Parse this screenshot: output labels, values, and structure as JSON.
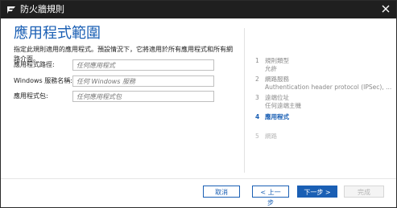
{
  "window": {
    "title": "防火牆規則"
  },
  "page": {
    "heading": "應用程式範圍",
    "description": "指定此規則適用的應用程式。預設情況下，它將適用於所有應用程式和所有網路介面。"
  },
  "fields": [
    {
      "label": "應用程式路徑:",
      "placeholder": "任何應用程式"
    },
    {
      "label": "Windows 服務名稱:",
      "placeholder": "任何 Windows 服務"
    },
    {
      "label": "應用程式包:",
      "placeholder": "任何應用程式包"
    }
  ],
  "steps": [
    {
      "num": "1",
      "label": "規則類型",
      "detail": "允許",
      "state": "done"
    },
    {
      "num": "2",
      "label": "網路服務",
      "detail": "Authentication header protocol (IPSec), ...",
      "state": "done"
    },
    {
      "num": "3",
      "label": "遠端位址",
      "detail": "任何遠端主機",
      "state": "done"
    },
    {
      "num": "4",
      "label": "應用程式",
      "detail": "",
      "state": "current"
    },
    {
      "num": "5",
      "label": "網路",
      "detail": "",
      "state": "disabled"
    }
  ],
  "buttons": {
    "cancel": "取消",
    "back": "< 上一步",
    "next": "下一步 >",
    "finish": "完成"
  },
  "colors": {
    "accent": "#1a5fb4",
    "titlebar": "#1f1f1f"
  },
  "icons": {
    "logo": "f-secure-logo-icon",
    "close": "close-icon"
  }
}
